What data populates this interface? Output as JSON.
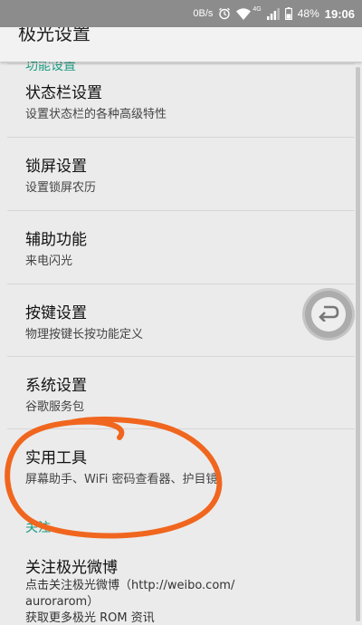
{
  "status_bar": {
    "net_speed": "0B/s",
    "network_type": "4G",
    "battery_percent": "48%",
    "time": "19:06",
    "icons": [
      "alarm-icon",
      "wifi-icon",
      "signal-icon",
      "battery-icon"
    ]
  },
  "title": "极光设置",
  "section_peek": "功能设置",
  "settings_items": [
    {
      "title": "状态栏设置",
      "subtitle": "设置状态栏的各种高级特性"
    },
    {
      "title": "锁屏设置",
      "subtitle": "设置锁屏农历"
    },
    {
      "title": "辅助功能",
      "subtitle": "来电闪光"
    },
    {
      "title": "按键设置",
      "subtitle": "物理按键长按功能定义"
    },
    {
      "title": "系统设置",
      "subtitle": "谷歌服务包"
    },
    {
      "title": "实用工具",
      "subtitle": "屏幕助手、WiFi 密码查看器、护目镜"
    }
  ],
  "follow_section": {
    "header": "关注",
    "item_title": "关注极光微博",
    "item_subtitle_line1": "点击关注极光微博（http://weibo.com/",
    "item_subtitle_line2": "aurorarom）",
    "item_subtitle_line3": "获取更多极光 ROM 资讯"
  },
  "colors": {
    "accent": "#1b9c82",
    "annotation": "#f0661e",
    "status_bar": "#8c8c8c",
    "background": "#ebebeb"
  }
}
